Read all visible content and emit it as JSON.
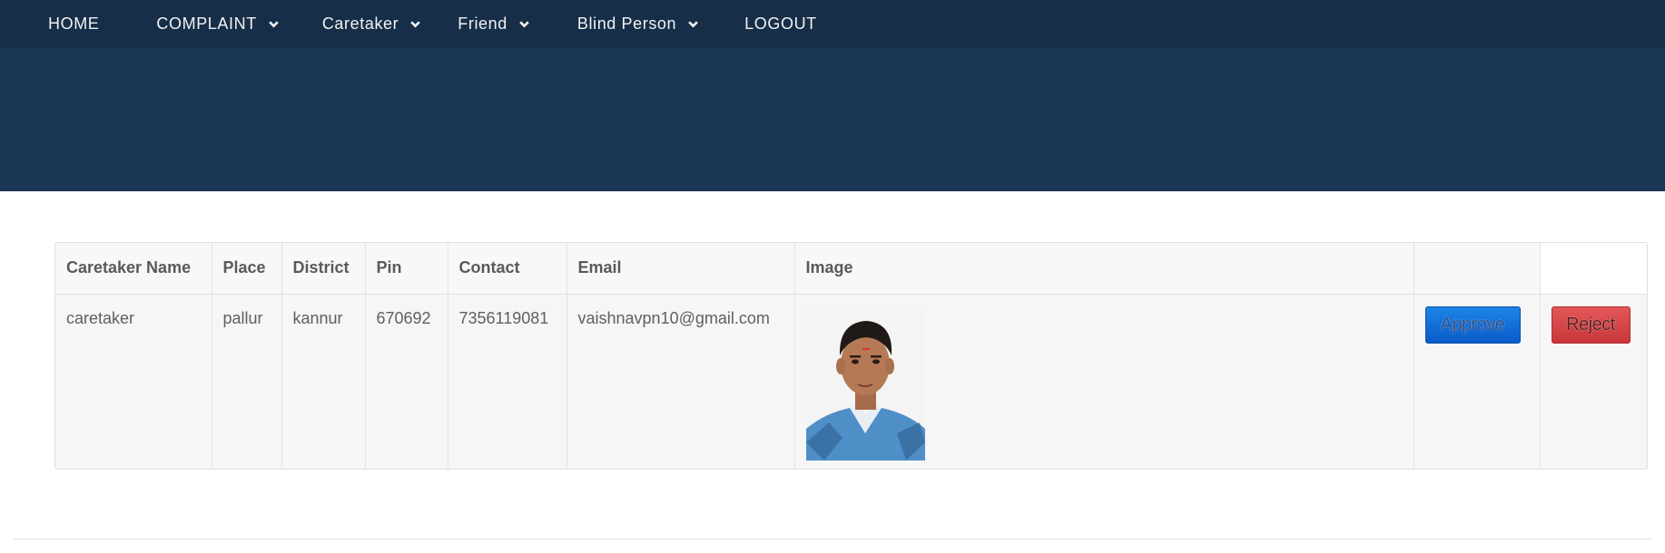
{
  "nav": {
    "items": [
      {
        "label": "HOME",
        "has_dropdown": false
      },
      {
        "label": "COMPLAINT",
        "has_dropdown": true
      },
      {
        "label": "Caretaker",
        "has_dropdown": true
      },
      {
        "label": "Friend",
        "has_dropdown": true
      },
      {
        "label": "Blind Person",
        "has_dropdown": true
      },
      {
        "label": "LOGOUT",
        "has_dropdown": false
      }
    ]
  },
  "colors": {
    "nav_bg": "#172e48",
    "hero_bg": "#1b3655",
    "approve": "#0a5bc9",
    "reject": "#c73638"
  },
  "table": {
    "headers": [
      "Caretaker Name",
      "Place",
      "District",
      "Pin",
      "Contact",
      "Email",
      "Image",
      "",
      ""
    ],
    "rows": [
      {
        "name": "caretaker",
        "place": "pallur",
        "district": "kannur",
        "pin": "670692",
        "contact": "7356119081",
        "email": "vaishnavpn10@gmail.com",
        "image_icon": "person-photo",
        "approve_label": "Approve",
        "reject_label": "Reject"
      }
    ]
  }
}
